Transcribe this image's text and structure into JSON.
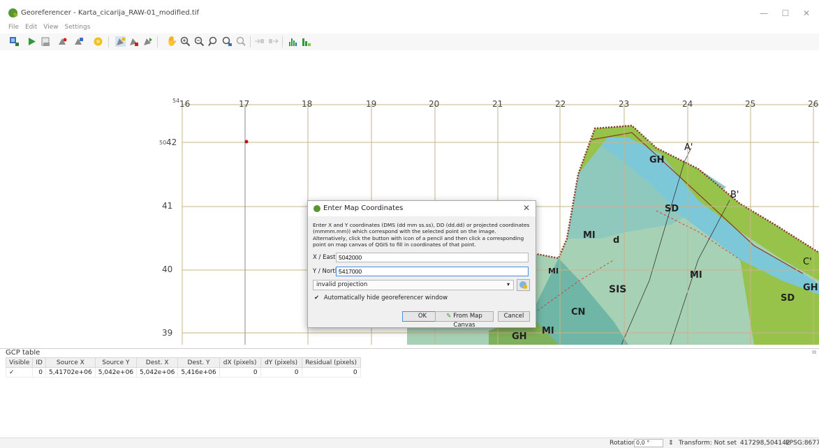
{
  "window": {
    "title": "Georeferencer - Karta_cicarija_RAW-01_modified.tif",
    "controls": {
      "minimize": "—",
      "maximize": "☐",
      "close": "✕"
    }
  },
  "menu": [
    "File",
    "Edit",
    "View",
    "Settings"
  ],
  "toolbar": {
    "icons": [
      "open-raster-icon",
      "start-georeferencing-icon",
      "generate-gdal-script-icon",
      "load-gcp-points-icon",
      "save-gcp-points-icon",
      "transformation-settings-icon",
      "add-point-icon",
      "delete-point-icon",
      "move-gcp-point-icon",
      "pan-icon",
      "zoom-in-icon",
      "zoom-out-icon",
      "zoom-to-layer-icon",
      "zoom-last-icon",
      "zoom-next-icon",
      "link-georef-to-qgis-icon",
      "link-qgis-to-georef-icon",
      "full-histogram-stretch-icon",
      "local-histogram-stretch-icon"
    ]
  },
  "annotations": {
    "a": "A",
    "b": "B",
    "c": "C",
    "d": "D"
  },
  "map": {
    "col_labels": [
      "16",
      "17",
      "18",
      "19",
      "20",
      "21",
      "22",
      "23",
      "24",
      "25",
      "26"
    ],
    "col_prefix": "54",
    "row_prefix": "50",
    "row_first": "42",
    "row_labels": [
      "41",
      "40",
      "39"
    ],
    "geology_labels": [
      "GH",
      "SD",
      "MI",
      "d",
      "SIS",
      "CN",
      "MI",
      "GH",
      "SD",
      "MI",
      "GH",
      "MI"
    ],
    "section_labels": [
      "A'",
      "B'",
      "C'"
    ]
  },
  "dialog": {
    "title": "Enter Map Coordinates",
    "description": "Enter X and Y coordinates (DMS (dd mm ss.ss), DD (dd.dd) or projected coordinates (mmmm.mm)) which correspond with the selected point on the image. Alternatively, click the button with icon of a pencil and then click a corresponding point on map canvas of QGIS to fill in coordinates of that point.",
    "x_label": "X / East",
    "x_value": "5042000",
    "y_label": "Y / North",
    "y_value": "5417000",
    "projection": "invalid projection",
    "auto_hide_label": "Automatically hide georeferencer window",
    "auto_hide_checked": true,
    "ok": "OK",
    "from_canvas": "From Map Canvas",
    "cancel": "Cancel"
  },
  "gcp_table": {
    "title": "GCP table",
    "columns": [
      "Visible",
      "ID",
      "Source X",
      "Source Y",
      "Dest. X",
      "Dest. Y",
      "dX (pixels)",
      "dY (pixels)",
      "Residual (pixels)"
    ],
    "rows": [
      [
        "✓",
        "0",
        "5,41702e+06",
        "5,042e+06",
        "5,042e+06",
        "5,416e+06",
        "0",
        "0",
        "0"
      ]
    ]
  },
  "status": {
    "rotation_label": "Rotation",
    "rotation_value": "0,0 °",
    "transform": "Transform: Not set",
    "coords": "417298,504142",
    "crs": "EPSG:8677"
  },
  "colors": {
    "annotation_red": "#d62020",
    "qgis_green": "#589632",
    "map_green": "#97c34a",
    "map_teal": "#8fc9bd",
    "map_blue": "#7cc8d8",
    "map_pale": "#a7d1b5",
    "fault_brown": "#8a3a2a"
  }
}
